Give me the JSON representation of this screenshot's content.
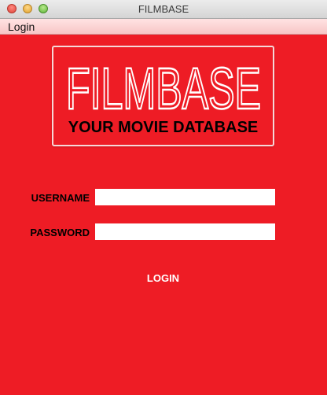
{
  "window": {
    "title": "FILMBASE"
  },
  "menubar": {
    "items": [
      {
        "label": "Login"
      }
    ]
  },
  "logo": {
    "title": "FILMBASE",
    "subtitle": "YOUR MOVIE DATABASE"
  },
  "form": {
    "username_label": "USERNAME",
    "username_value": "",
    "password_label": "PASSWORD",
    "password_value": "",
    "login_label": "LOGIN"
  },
  "colors": {
    "background": "#ee1c25",
    "logo_text": "#ffffff",
    "label_text": "#000000",
    "button_text": "#ffffff"
  }
}
